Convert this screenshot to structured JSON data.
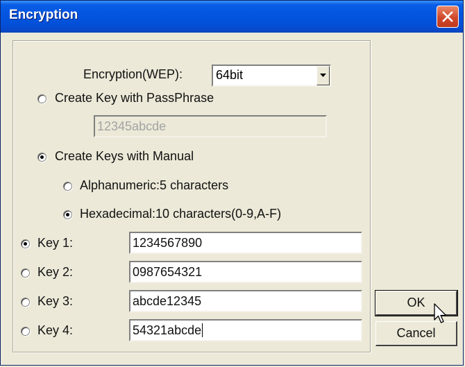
{
  "window": {
    "title": "Encryption"
  },
  "encryption": {
    "label": "Encryption(WEP):",
    "selected": "64bit"
  },
  "passphrase": {
    "label": "Create Key with PassPhrase",
    "value": "12345abcde"
  },
  "manual": {
    "label": "Create Keys with Manual",
    "alphanumeric_label": "Alphanumeric:5 characters",
    "hexadecimal_label": "Hexadecimal:10 characters(0-9,A-F)"
  },
  "keys": [
    {
      "label": "Key 1:",
      "value": "1234567890",
      "selected": true
    },
    {
      "label": "Key 2:",
      "value": "0987654321",
      "selected": false
    },
    {
      "label": "Key 3:",
      "value": "abcde12345",
      "selected": false
    },
    {
      "label": "Key 4:",
      "value": "54321abcde",
      "selected": false
    }
  ],
  "buttons": {
    "ok": "OK",
    "cancel": "Cancel"
  }
}
